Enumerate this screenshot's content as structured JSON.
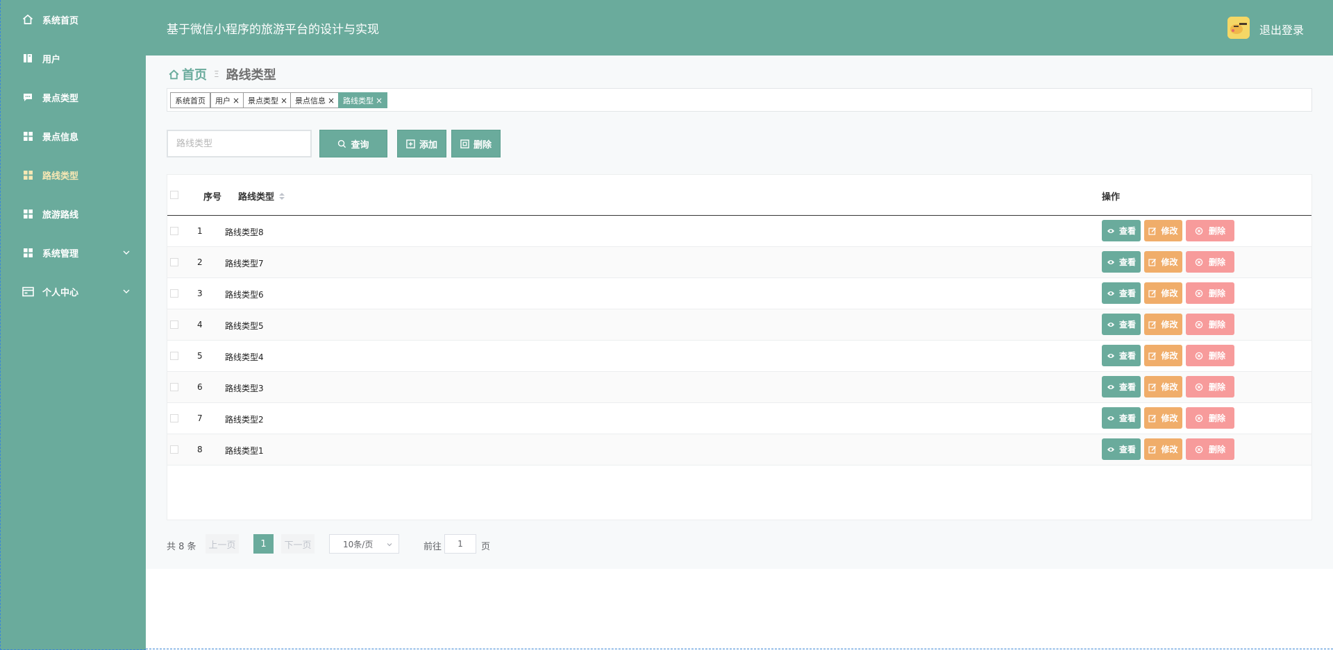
{
  "colors": {
    "brand": "#6aab9c",
    "active_menu": "#f7e7b4",
    "view": "#6aab9c",
    "edit": "#f0ad6a",
    "delete": "#f79b9b"
  },
  "sidebar": {
    "items": [
      {
        "label": "系统首页",
        "icon": "home-icon"
      },
      {
        "label": "用户",
        "icon": "user-book-icon"
      },
      {
        "label": "景点类型",
        "icon": "chat-icon"
      },
      {
        "label": "景点信息",
        "icon": "grid-icon"
      },
      {
        "label": "路线类型",
        "icon": "grid-icon",
        "active": true
      },
      {
        "label": "旅游路线",
        "icon": "grid-icon"
      },
      {
        "label": "系统管理",
        "icon": "grid-icon",
        "expandable": true
      },
      {
        "label": "个人中心",
        "icon": "card-icon",
        "expandable": true
      }
    ]
  },
  "header": {
    "title": "基于微信小程序的旅游平台的设计与实现",
    "logout": "退出登录"
  },
  "breadcrumb": {
    "home": "首页",
    "current": "路线类型"
  },
  "tags": [
    {
      "label": "系统首页",
      "closable": false
    },
    {
      "label": "用户",
      "closable": true
    },
    {
      "label": "景点类型",
      "closable": true
    },
    {
      "label": "景点信息",
      "closable": true
    },
    {
      "label": "路线类型",
      "closable": true,
      "active": true
    }
  ],
  "search": {
    "placeholder": "路线类型",
    "query_label": "查询",
    "add_label": "添加",
    "delete_label": "删除"
  },
  "table": {
    "headers": {
      "index": "序号",
      "type": "路线类型",
      "actions": "操作"
    },
    "rows": [
      {
        "index": "1",
        "type": "路线类型8"
      },
      {
        "index": "2",
        "type": "路线类型7"
      },
      {
        "index": "3",
        "type": "路线类型6"
      },
      {
        "index": "4",
        "type": "路线类型5"
      },
      {
        "index": "5",
        "type": "路线类型4"
      },
      {
        "index": "6",
        "type": "路线类型3"
      },
      {
        "index": "7",
        "type": "路线类型2"
      },
      {
        "index": "8",
        "type": "路线类型1"
      }
    ],
    "actions": {
      "view": "查看",
      "edit": "修改",
      "delete": "删除"
    }
  },
  "pagination": {
    "total": "共 8 条",
    "prev": "上一页",
    "current": "1",
    "next": "下一页",
    "page_size": "10条/页",
    "goto_label": "前往",
    "goto_value": "1",
    "goto_unit": "页"
  }
}
